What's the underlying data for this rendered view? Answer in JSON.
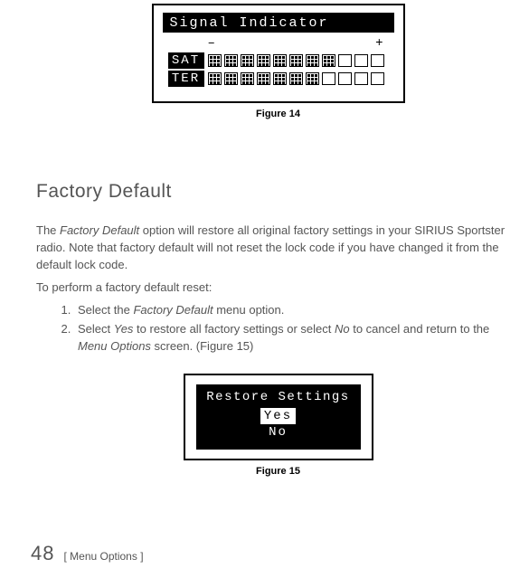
{
  "figure14": {
    "title": "Signal Indicator",
    "minus": "–",
    "plus": "+",
    "rows": [
      {
        "label": "SAT"
      },
      {
        "label": "TER"
      }
    ],
    "caption": "Figure 14"
  },
  "section_heading": "Factory Default",
  "intro_para": "The Factory Default option will restore all original factory settings in your SIRIUS Sportster radio. Note that factory default will not reset the lock code if you have changed it from the default lock code.",
  "subhead": "To perform a factory default reset:",
  "step1_a": "Select the ",
  "step1_term": "Factory Default",
  "step1_b": " menu option.",
  "step2_a": "Select ",
  "step2_yes": "Yes",
  "step2_b": " to restore all factory settings or select ",
  "step2_no": "No",
  "step2_c": " to cancel and return to the ",
  "step2_menu": "Menu Options",
  "step2_d": " screen. (Figure 15)",
  "figure15": {
    "title": "Restore Settings",
    "opt_yes": "Yes",
    "opt_no": "No",
    "caption": "Figure 15"
  },
  "footer": {
    "page": "48",
    "crumb": "[ Menu Options ]"
  }
}
